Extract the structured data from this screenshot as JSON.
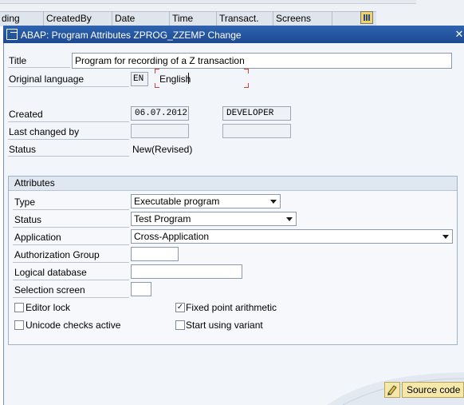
{
  "background_table": {
    "columns": [
      "ding",
      "CreatedBy",
      "Date",
      "Time",
      "Transact.",
      "Screens"
    ]
  },
  "dialog": {
    "title": "ABAP: Program Attributes ZPROG_ZZEMP Change",
    "title_icon": "change-icon",
    "close_label": "✕"
  },
  "header": {
    "title_label": "Title",
    "title_value": "Program for recording of a Z transaction",
    "orig_lang_label": "Original language",
    "orig_lang_code": "EN",
    "orig_lang_text": "English",
    "created_label": "Created",
    "created_date": "06.07.2012",
    "created_user": "DEVELOPER",
    "last_changed_label": "Last changed by",
    "last_changed_date": "",
    "last_changed_user": "",
    "status_label": "Status",
    "status_value": "New(Revised)"
  },
  "attributes": {
    "group_title": "Attributes",
    "type_label": "Type",
    "type_value": "Executable program",
    "status_label": "Status",
    "status_value": "Test Program",
    "application_label": "Application",
    "application_value": "Cross-Application",
    "auth_group_label": "Authorization Group",
    "auth_group_value": "",
    "logical_db_label": "Logical database",
    "logical_db_value": "",
    "selection_screen_label": "Selection screen",
    "selection_screen_value": "",
    "checkboxes": {
      "editor_lock": {
        "label": "Editor lock",
        "checked": false
      },
      "fixed_point": {
        "label": "Fixed point arithmetic",
        "checked": true
      },
      "unicode": {
        "label": "Unicode checks active",
        "checked": false
      },
      "start_variant": {
        "label": "Start using variant",
        "checked": false
      }
    }
  },
  "footer": {
    "source_code_label": "Source code",
    "pencil_icon": "pencil-icon"
  },
  "colors": {
    "titlebar": "#1c4a91",
    "lang_bracket": "#d0433a",
    "button_bg": "#f6e8a8"
  }
}
